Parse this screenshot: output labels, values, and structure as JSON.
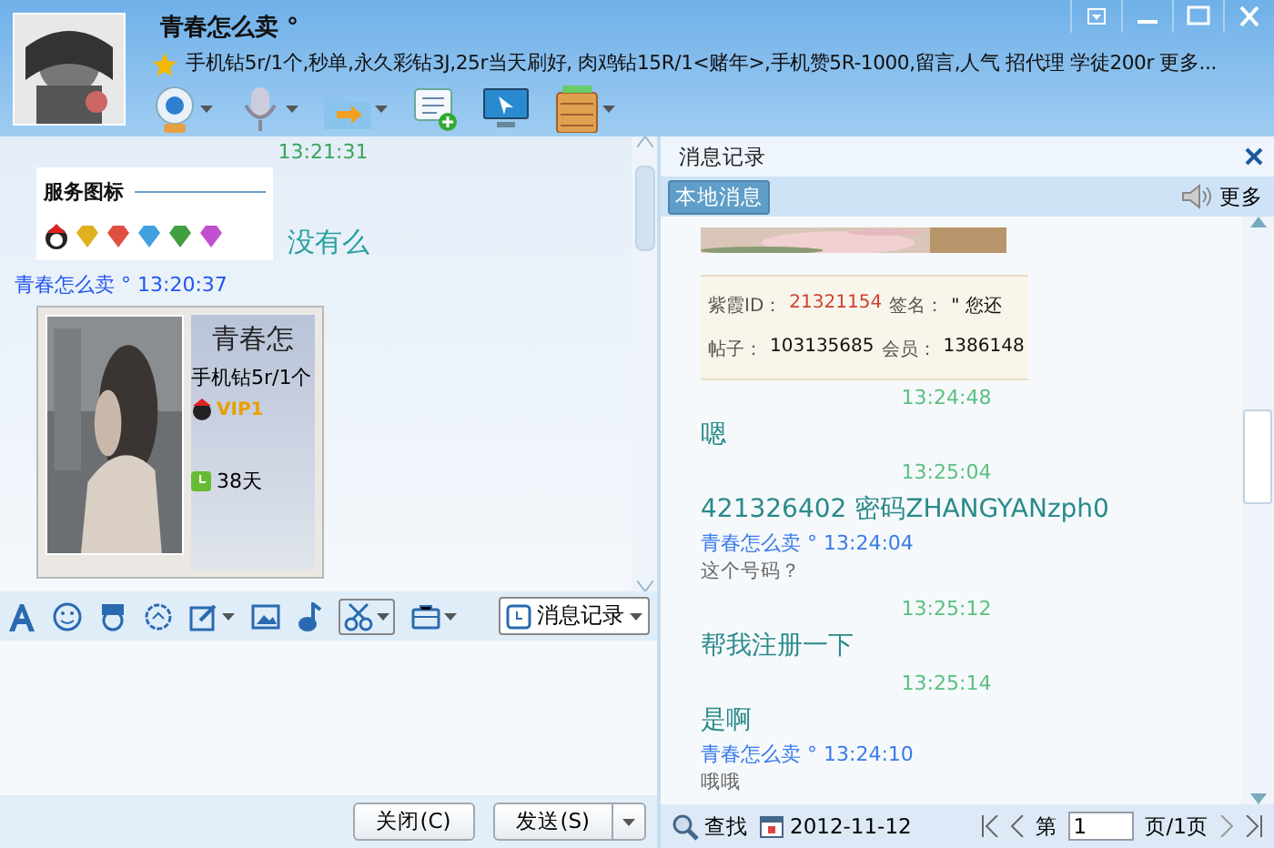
{
  "window": {
    "name": "青春怎么卖 °",
    "signature": "手机钻5r/1个,秒单,永久彩钻3J,25r当天刷好, 肉鸡钻15R/1<赌年>,手机赞5R-1000,留言,人气 招代理  学徒200r 更多..."
  },
  "chat": {
    "messages": [
      {
        "kind": "time",
        "text": "13:21:31"
      },
      {
        "kind": "service_card",
        "title": "服务图标",
        "reply": "没有么"
      },
      {
        "kind": "sender",
        "name": "青春怎么卖 °",
        "time": "13:20:37"
      },
      {
        "kind": "profile_shot",
        "name": "青春怎",
        "signature": "手机钻5r/1个",
        "vip": "VIP1",
        "days": "38天"
      }
    ]
  },
  "input_toolbar": {
    "history_button": "消息记录"
  },
  "buttons": {
    "close": "关闭(C)",
    "send": "发送(S)"
  },
  "history": {
    "title": "消息记录",
    "tab": "本地消息",
    "more": "更多",
    "info_card": {
      "rows": [
        [
          {
            "label": "紫霞ID：",
            "value": "21321154",
            "highlight": true
          },
          {
            "label": "签名：",
            "value": "\" 您还",
            "highlight": false
          }
        ],
        [
          {
            "label": "帖子：",
            "value": "103135685",
            "highlight": false
          },
          {
            "label": "会员：",
            "value": "1386148",
            "highlight": false
          }
        ]
      ]
    },
    "messages": [
      {
        "kind": "time",
        "text": "13:24:48"
      },
      {
        "kind": "mine",
        "text": "嗯"
      },
      {
        "kind": "time",
        "text": "13:25:04"
      },
      {
        "kind": "mine",
        "text": "421326402   密码ZHANGYANzph0"
      },
      {
        "kind": "sender",
        "name": "青春怎么卖 °",
        "time": "13:24:04"
      },
      {
        "kind": "theirs",
        "text": "这个号码？"
      },
      {
        "kind": "time",
        "text": "13:25:12"
      },
      {
        "kind": "mine",
        "text": "帮我注册一下"
      },
      {
        "kind": "time",
        "text": "13:25:14"
      },
      {
        "kind": "mine",
        "text": "是啊"
      },
      {
        "kind": "sender",
        "name": "青春怎么卖 °",
        "time": "13:24:10"
      },
      {
        "kind": "theirs",
        "text": "哦哦"
      }
    ],
    "footer": {
      "search": "查找",
      "date": "2012-11-12",
      "page_prefix": "第",
      "page": "1",
      "page_suffix": "页/1页"
    }
  }
}
